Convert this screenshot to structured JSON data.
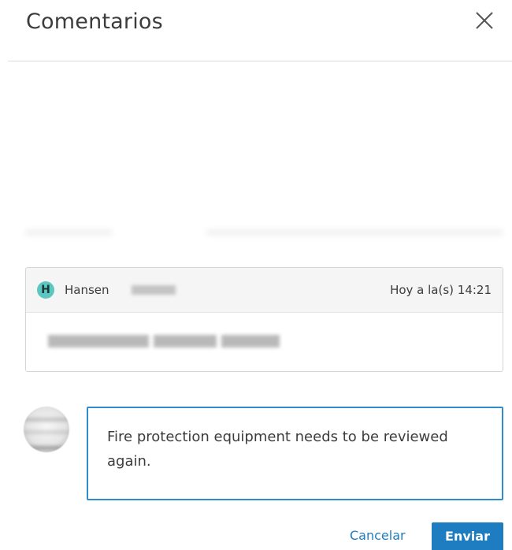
{
  "header": {
    "title": "Comentarios",
    "close_icon": "close-icon"
  },
  "comment": {
    "author_initial": "H",
    "author_name": "Hansen",
    "timestamp": "Hoy a la(s) 14:21",
    "avatar_color": "#5cc7c0"
  },
  "reply": {
    "value": "Fire protection equipment needs to be reviewed again."
  },
  "actions": {
    "cancel_label": "Cancelar",
    "send_label": "Enviar"
  },
  "colors": {
    "accent": "#1e7cc0",
    "input_border": "#2f8ccd",
    "divider": "#dcdcdc"
  }
}
